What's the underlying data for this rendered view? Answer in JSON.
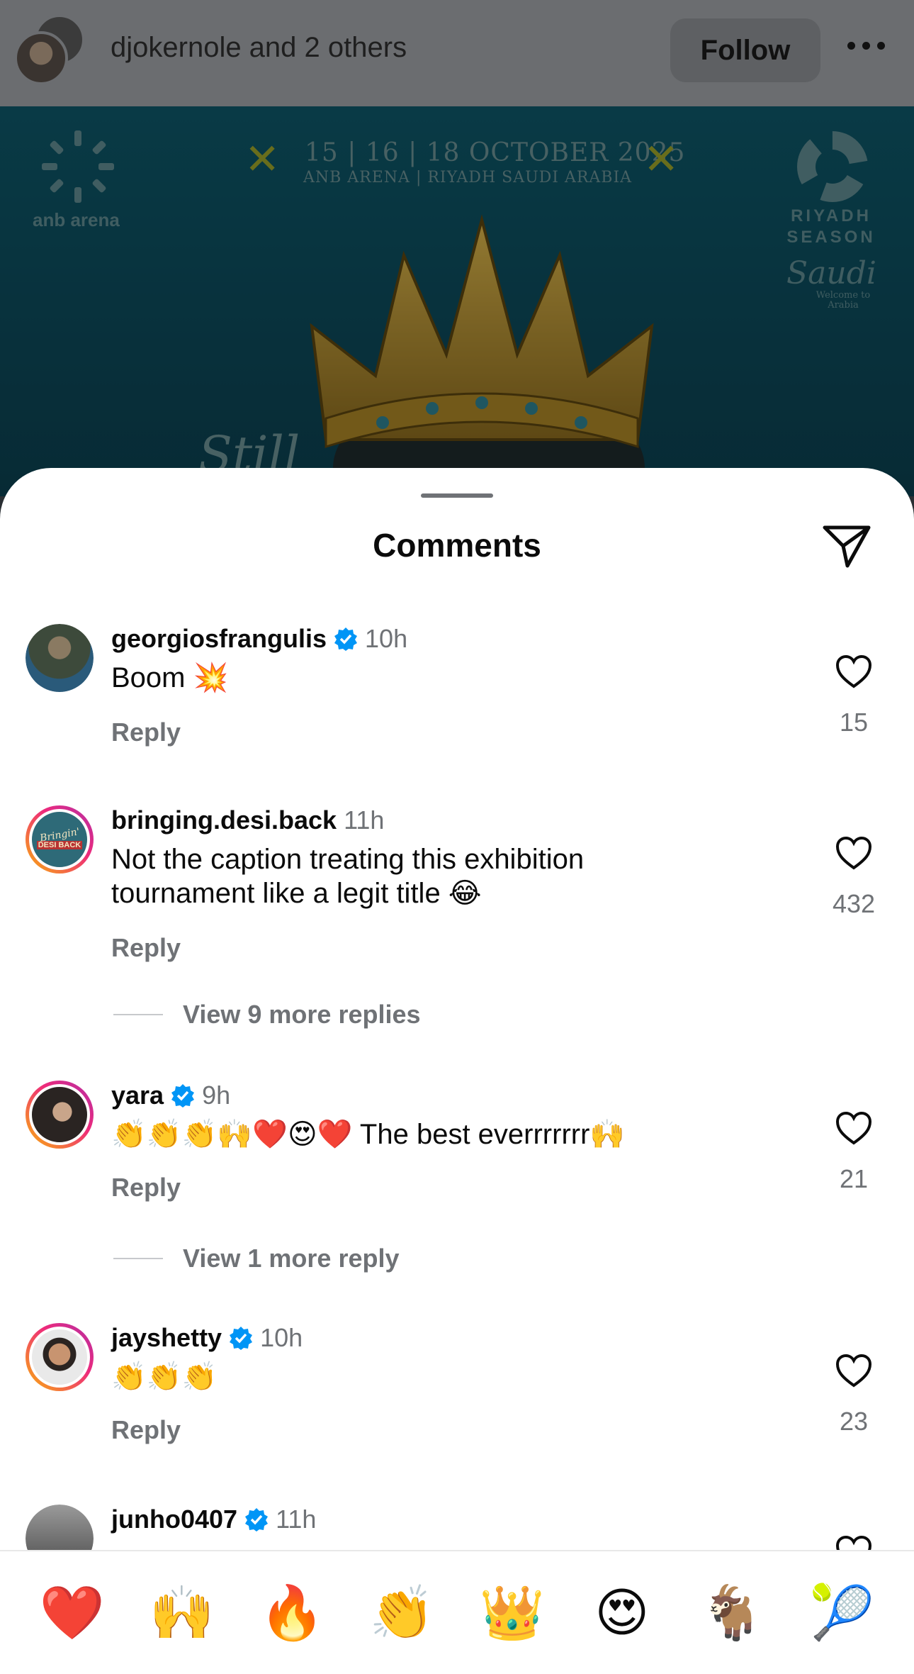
{
  "header": {
    "owner_text": "djokernole and 2 others",
    "follow_label": "Follow"
  },
  "post": {
    "event_date": "15 | 16 | 18 OCTOBER 2025",
    "event_venue": "ANB ARENA  |  RIYADH SAUDI ARABIA",
    "anb_logo_text": "anb arena",
    "season_text": "RIYADH SEASON",
    "saudi_text": "Saudi",
    "saudi_sub": "Welcome to Arabia",
    "partial_text": "Still"
  },
  "sheet": {
    "title": "Comments"
  },
  "comments": [
    {
      "username": "georgiosfrangulis",
      "verified": true,
      "time": "10h",
      "text": "Boom 💥",
      "reply_label": "Reply",
      "likes": "15"
    },
    {
      "username": "bringing.desi.back",
      "verified": false,
      "time": "11h",
      "text": "Not the caption treating this exhibition tournament like a legit title 😂",
      "reply_label": "Reply",
      "likes": "432",
      "view_more": "View 9 more replies",
      "avatar_text_1": "Bringin'",
      "avatar_text_2": "DESI BACK"
    },
    {
      "username": "yara",
      "verified": true,
      "time": "9h",
      "text": "👏👏👏🙌❤️😍❤️ The best everrrrrrr🙌",
      "reply_label": "Reply",
      "likes": "21",
      "view_more": "View 1 more reply"
    },
    {
      "username": "jayshetty",
      "verified": true,
      "time": "10h",
      "text": "👏👏👏",
      "reply_label": "Reply",
      "likes": "23"
    },
    {
      "username": "junho0407",
      "verified": true,
      "time": "11h"
    }
  ],
  "reactions": [
    {
      "emoji": "❤️",
      "icon": "red-heart"
    },
    {
      "emoji": "🙌",
      "icon": "raising-hands"
    },
    {
      "emoji": "🔥",
      "icon": "fire"
    },
    {
      "emoji": "👏",
      "icon": "clapping-hands"
    },
    {
      "emoji": "👑",
      "icon": "crown"
    },
    {
      "emoji": "😍",
      "icon": "heart-eyes"
    },
    {
      "emoji": "🐐",
      "icon": "goat"
    },
    {
      "emoji": "🎾",
      "icon": "tennis-ball"
    }
  ],
  "colors": {
    "verified_blue": "#0095f6",
    "muted_text": "#6f7276",
    "accent_ring_start": "#f9b10b",
    "accent_ring_end": "#b22fa7"
  }
}
